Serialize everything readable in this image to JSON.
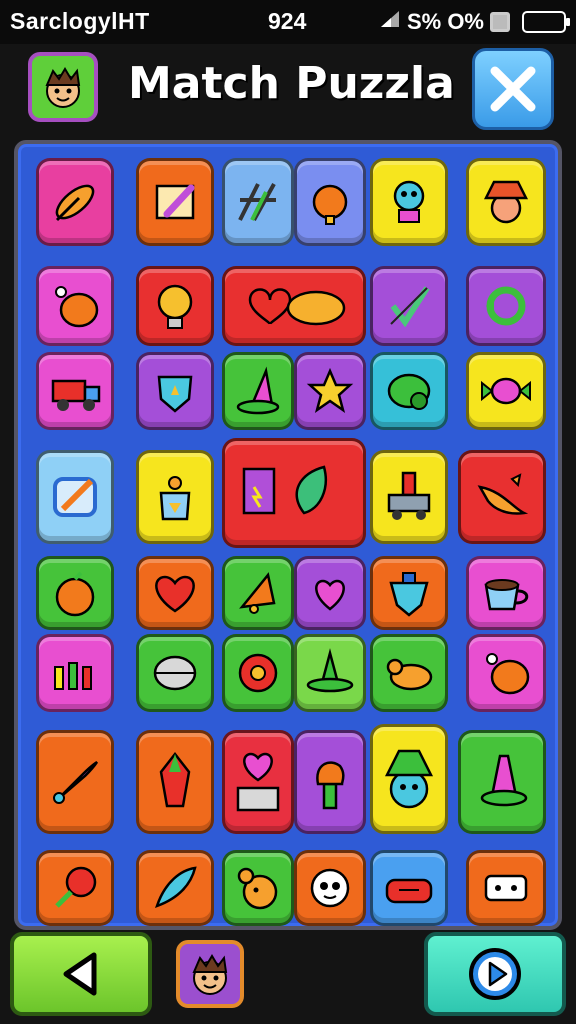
{
  "status_bar": {
    "carrier": "SarclogylHT",
    "time": "924",
    "indicators": "S% O%",
    "icons": [
      "signal-icon",
      "wifi-icon",
      "screenshot-icon",
      "battery-icon"
    ]
  },
  "header": {
    "title": "Match Puzzla",
    "left_icon": "avatar-icon",
    "right_icon": "close-icon"
  },
  "board": {
    "tiles": [
      {
        "icon": "feather-icon",
        "color": "#e83fa0"
      },
      {
        "icon": "pencil-frame-icon",
        "color": "#f06a1c"
      },
      {
        "icon": "tools-icon",
        "color": "#7cb4f0"
      },
      {
        "icon": "bell-icon",
        "color": "#7a8ef0"
      },
      {
        "icon": "robot-face-icon",
        "color": "#f6e51e"
      },
      {
        "icon": "hat-face-icon",
        "color": "#f6e51e"
      },
      {
        "icon": "chicken-leg-icon",
        "color": "#e84fd0"
      },
      {
        "icon": "light-bulb-icon",
        "color": "#e83030"
      },
      {
        "icon": "heart-mango-icon",
        "color": "#e83030"
      },
      {
        "icon": "check-pencil-icon",
        "color": "#a44fd8"
      },
      {
        "icon": "recycle-icon",
        "color": "#a44fd8"
      },
      {
        "icon": "truck-icon",
        "color": "#e84fd0"
      },
      {
        "icon": "shield-icon",
        "color": "#a44fd8"
      },
      {
        "icon": "cone-hat-icon",
        "color": "#46c33a"
      },
      {
        "icon": "star-icon",
        "color": "#a44fd8"
      },
      {
        "icon": "green-blob-icon",
        "color": "#36c0d8"
      },
      {
        "icon": "candy-icon",
        "color": "#f6e51e"
      },
      {
        "icon": "pen-pad-icon",
        "color": "#8fd0f6"
      },
      {
        "icon": "teapot-icon",
        "color": "#f6e51e"
      },
      {
        "icon": "battery-leaf-icon",
        "color": "#e83030"
      },
      {
        "icon": "tower-cart-icon",
        "color": "#f6e51e"
      },
      {
        "icon": "dragon-icon",
        "color": "#e83030"
      },
      {
        "icon": "orange-icon",
        "color": "#46c33a"
      },
      {
        "icon": "heart-icon",
        "color": "#f06a1c"
      },
      {
        "icon": "bell-cone-icon",
        "color": "#46c33a"
      },
      {
        "icon": "small-heart-icon",
        "color": "#a44fd8"
      },
      {
        "icon": "potion-icon",
        "color": "#f06a1c"
      },
      {
        "icon": "cup-icon",
        "color": "#e84fd0"
      },
      {
        "icon": "candles-icon",
        "color": "#e84fd0"
      },
      {
        "icon": "dome-icon",
        "color": "#46c33a"
      },
      {
        "icon": "flower-icon",
        "color": "#46c33a"
      },
      {
        "icon": "green-hat-icon",
        "color": "#7ad84a"
      },
      {
        "icon": "bird-icon",
        "color": "#46c33a"
      },
      {
        "icon": "drumstick-icon",
        "color": "#e84fd0"
      },
      {
        "icon": "rocket-icon",
        "color": "#f06a1c"
      },
      {
        "icon": "crystal-icon",
        "color": "#f06a1c"
      },
      {
        "icon": "heart-keypad-icon",
        "color": "#e83040"
      },
      {
        "icon": "torch-icon",
        "color": "#a44fd8"
      },
      {
        "icon": "monster-icon",
        "color": "#f6e51e"
      },
      {
        "icon": "traffic-cone-icon",
        "color": "#46c33a"
      },
      {
        "icon": "lollipop-icon",
        "color": "#f06a1c"
      },
      {
        "icon": "leaf-feather-icon",
        "color": "#f06a1c"
      },
      {
        "icon": "creature-icon",
        "color": "#46c33a"
      },
      {
        "icon": "face-icon",
        "color": "#f06a1c"
      },
      {
        "icon": "radio-icon",
        "color": "#4aa0f0"
      },
      {
        "icon": "puzzle-icon",
        "color": "#f06a1c"
      }
    ]
  },
  "footer": {
    "back_icon": "back-arrow-icon",
    "avatar_icon": "avatar-icon",
    "play_icon": "play-icon"
  }
}
